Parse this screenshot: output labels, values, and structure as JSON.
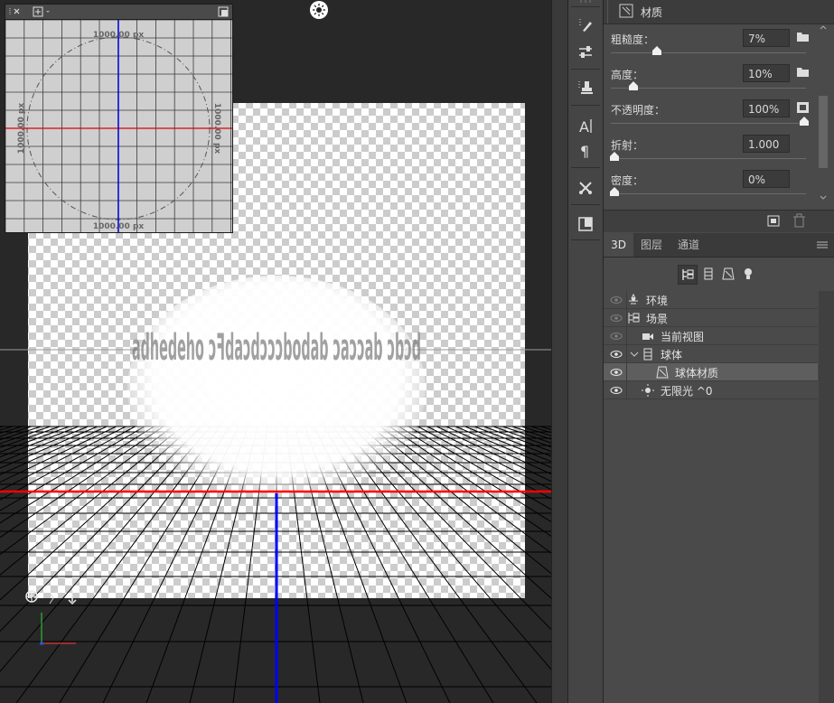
{
  "nav_widget": {
    "dimension_top": "1000.00 px",
    "dimension_bottom": "1000.00 px",
    "dimension_left": "1000.00 px",
    "dimension_right": "1000.00 px"
  },
  "canvas": {
    "text_3d": "adhedeho ɔꟻdaɔdɔɔɔbodab ɔaɔɔab ɔbɔd"
  },
  "properties": {
    "tab_label": "材质",
    "rows": [
      {
        "label": "粗糙度：",
        "value": "7%",
        "slider": 0.22
      },
      {
        "label": "高度：",
        "value": "10%",
        "slider": 0.1
      },
      {
        "label": "不透明度：",
        "value": "100%",
        "slider": 0.99
      },
      {
        "label": "折射：",
        "value": "1.000",
        "slider": 0.0
      },
      {
        "label": "密度：",
        "value": "0%",
        "slider": 0.0
      }
    ]
  },
  "panel3d": {
    "tabs": [
      {
        "label": "3D"
      },
      {
        "label": "图层"
      },
      {
        "label": "通道"
      }
    ],
    "tree": [
      {
        "label": "环境",
        "icon": "environment-icon",
        "visible_dim": true
      },
      {
        "label": "场景",
        "icon": "scene-icon",
        "visible_dim": true
      },
      {
        "label": "当前视图",
        "icon": "camera-icon",
        "visible_dim": true
      },
      {
        "label": "球体",
        "icon": "mesh-icon",
        "visible_dim": false
      },
      {
        "label": "球体材质",
        "icon": "material-icon",
        "visible_dim": false,
        "selected": true
      },
      {
        "label": "无限光 ^0",
        "icon": "light-icon",
        "visible_dim": false
      }
    ]
  },
  "colors": {
    "x_axis": "#ff0000",
    "y_axis": "#0000ff",
    "panel_bg": "#4a4a4a",
    "selected_row": "#5e5e5e"
  }
}
